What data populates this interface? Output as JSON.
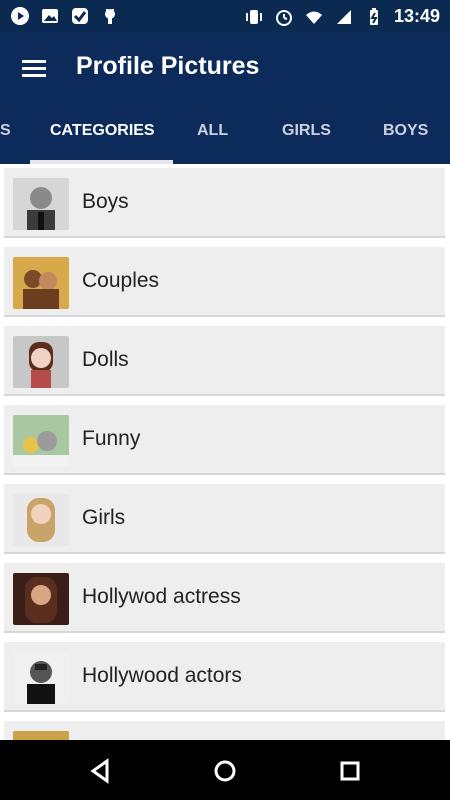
{
  "status_bar": {
    "time": "13:49",
    "left_icons": [
      "play-icon",
      "image-icon",
      "check-icon",
      "android-icon"
    ],
    "right_icons": [
      "vibrate-icon",
      "alarm-icon",
      "wifi-icon",
      "signal-icon",
      "battery-icon"
    ]
  },
  "app_bar": {
    "title": "Profile Pictures",
    "menu_icon": "menu-icon"
  },
  "tabs": [
    {
      "label": "S"
    },
    {
      "label": "CATEGORIES"
    },
    {
      "label": "ALL"
    },
    {
      "label": "GIRLS"
    },
    {
      "label": "BOYS"
    }
  ],
  "list": {
    "items": [
      {
        "label": "Boys",
        "thumb": "boy-photo"
      },
      {
        "label": "Couples",
        "thumb": "couple-photo"
      },
      {
        "label": "Dolls",
        "thumb": "doll-photo"
      },
      {
        "label": "Funny",
        "thumb": "funny-animals-photo"
      },
      {
        "label": "Girls",
        "thumb": "girl-photo"
      },
      {
        "label": "Hollywod actress",
        "thumb": "actress-photo"
      },
      {
        "label": "Hollywood actors",
        "thumb": "actor-photo"
      },
      {
        "label": "",
        "thumb": "partial-photo"
      }
    ]
  },
  "colors": {
    "primary": "#0d2b5a",
    "status_bar": "#0a2a52",
    "list_bg": "#eeeeee"
  },
  "nav_bar": {
    "buttons": [
      "back-icon",
      "home-icon",
      "recents-icon"
    ]
  }
}
